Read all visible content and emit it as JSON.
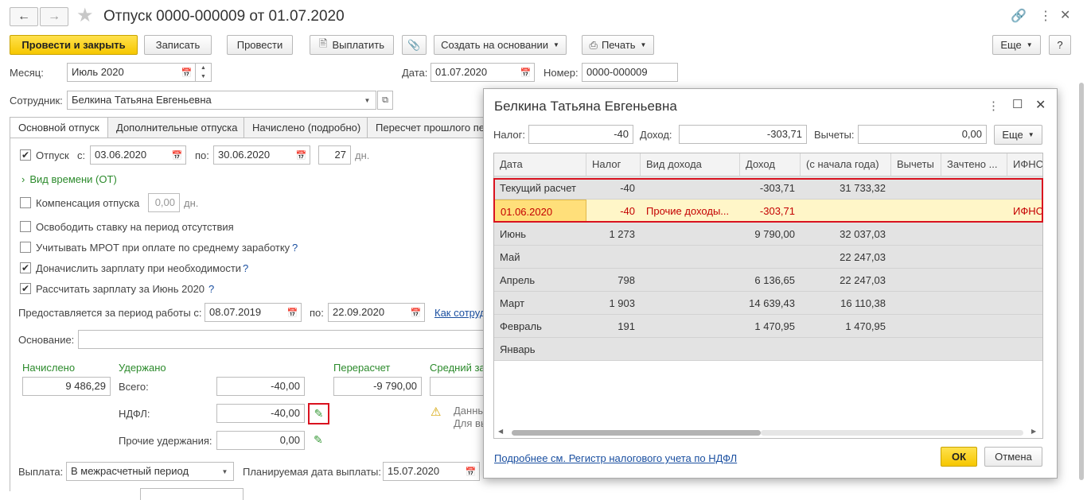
{
  "window": {
    "title": "Отпуск 0000-000009 от 01.07.2020"
  },
  "toolbar": {
    "post_close": "Провести и закрыть",
    "save": "Записать",
    "post": "Провести",
    "pay": "Выплатить",
    "create_based": "Создать на основании",
    "print": "Печать",
    "more": "Еще",
    "help": "?"
  },
  "header": {
    "month_label": "Месяц:",
    "month_value": "Июль 2020",
    "date_label": "Дата:",
    "date_value": "01.07.2020",
    "number_label": "Номер:",
    "number_value": "0000-000009",
    "employee_label": "Сотрудник:",
    "employee_value": "Белкина Татьяна Евгеньевна"
  },
  "tabs": [
    {
      "label": "Основной отпуск",
      "active": true
    },
    {
      "label": "Дополнительные отпуска",
      "active": false
    },
    {
      "label": "Начислено (подробно)",
      "active": false
    },
    {
      "label": "Пересчет прошлого пе",
      "active": false
    }
  ],
  "main": {
    "vacation_label": "Отпуск",
    "from_label": "с:",
    "from_value": "03.06.2020",
    "to_label": "по:",
    "to_value": "30.06.2020",
    "days_value": "27",
    "days_unit": "дн.",
    "time_type": "Вид времени (ОТ)",
    "compensation_label": "Компенсация отпуска",
    "compensation_value": "0,00",
    "compensation_unit": "дн.",
    "free_rate_label": "Освободить ставку на период отсутствия",
    "mrot_label": "Учитывать МРОТ при оплате по среднему заработку",
    "add_salary_label": "Доначислить зарплату при необходимости",
    "calc_salary_label": "Рассчитать зарплату за Июнь 2020",
    "question": "?",
    "period_label": "Предоставляется за период работы с:",
    "period_from": "08.07.2019",
    "period_to_label": "по:",
    "period_to": "22.09.2020",
    "how_link": "Как сотруд",
    "basis_label": "Основание:",
    "basis_value": "",
    "accrued_label": "Начислено",
    "accrued_value": "9 486,29",
    "withheld_label": "Удержано",
    "total_label": "Всего:",
    "total_value": "-40,00",
    "ndfl_label": "НДФЛ:",
    "ndfl_value": "-40,00",
    "other_label": "Прочие удержания:",
    "other_value": "0,00",
    "recalc_label": "Перерасчет",
    "recalc_value": "-9 790,00",
    "avg_label": "Средний за",
    "warning_line1": "Данны",
    "warning_line2": "Для вы",
    "payout_label": "Выплата:",
    "payout_value": "В межрасчетный период",
    "planned_date_label": "Планируемая дата выплаты:",
    "planned_date_value": "15.07.2020"
  },
  "dialog": {
    "title": "Белкина Татьяна Евгеньевна",
    "tax_label": "Налог:",
    "tax_value": "-40",
    "income_label": "Доход:",
    "income_value": "-303,71",
    "deductions_label": "Вычеты:",
    "deductions_value": "0,00",
    "more": "Еще",
    "columns": [
      "Дата",
      "Налог",
      "Вид дохода",
      "Доход",
      "(с начала года)",
      "Вычеты",
      "Зачтено ...",
      "ИФНС"
    ],
    "rows": [
      {
        "date": "Текущий расчет",
        "tax": "-40",
        "kind": "",
        "income": "-303,71",
        "ytd": "31 733,32",
        "ded": "",
        "credited": "",
        "ifns": ""
      },
      {
        "date": "01.06.2020",
        "tax": "-40",
        "kind": "Прочие доходы...",
        "income": "-303,71",
        "ytd": "",
        "ded": "",
        "credited": "",
        "ifns": "ИФНС"
      },
      {
        "date": "Июнь",
        "tax": "1 273",
        "kind": "",
        "income": "9 790,00",
        "ytd": "32 037,03",
        "ded": "",
        "credited": "",
        "ifns": ""
      },
      {
        "date": "Май",
        "tax": "",
        "kind": "",
        "income": "",
        "ytd": "22 247,03",
        "ded": "",
        "credited": "",
        "ifns": ""
      },
      {
        "date": "Апрель",
        "tax": "798",
        "kind": "",
        "income": "6 136,65",
        "ytd": "22 247,03",
        "ded": "",
        "credited": "",
        "ifns": ""
      },
      {
        "date": "Март",
        "tax": "1 903",
        "kind": "",
        "income": "14 639,43",
        "ytd": "16 110,38",
        "ded": "",
        "credited": "",
        "ifns": ""
      },
      {
        "date": "Февраль",
        "tax": "191",
        "kind": "",
        "income": "1 470,95",
        "ytd": "1 470,95",
        "ded": "",
        "credited": "",
        "ifns": ""
      },
      {
        "date": "Январь",
        "tax": "",
        "kind": "",
        "income": "",
        "ytd": "",
        "ded": "",
        "credited": "",
        "ifns": ""
      }
    ],
    "footer_link": "Подробнее см. Регистр налогового учета по НДФЛ",
    "ok": "ОК",
    "cancel": "Отмена"
  },
  "colors": {
    "accent_yellow": "#f6c700",
    "highlight_red": "#d9121f",
    "selected_row": "#fff6c8",
    "group_row": "#e3e3e3"
  }
}
